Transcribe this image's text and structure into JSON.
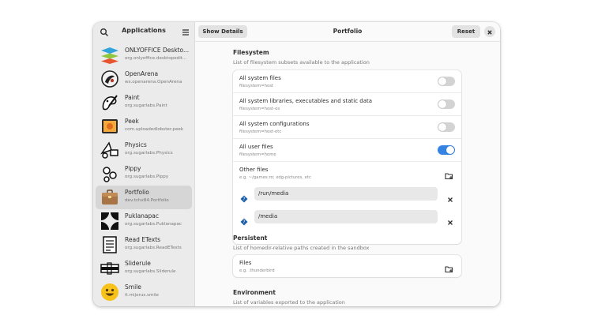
{
  "sidebar": {
    "title": "Applications",
    "apps": [
      {
        "name": "ONLYOFFICE Deskto...",
        "id": "org.onlyoffice.desktopedit...",
        "icon": "onlyoffice-icon"
      },
      {
        "name": "OpenArena",
        "id": "ws.openarena.OpenArena",
        "icon": "openarena-icon"
      },
      {
        "name": "Paint",
        "id": "org.sugarlabs.Paint",
        "icon": "paint-icon"
      },
      {
        "name": "Peek",
        "id": "com.uploadedlobster.peek",
        "icon": "peek-icon"
      },
      {
        "name": "Physics",
        "id": "org.sugarlabs.Physics",
        "icon": "physics-icon"
      },
      {
        "name": "Pippy",
        "id": "org.sugarlabs.Pippy",
        "icon": "pippy-icon"
      },
      {
        "name": "Portfolio",
        "id": "dev.tchx84.Portfolio",
        "icon": "portfolio-icon",
        "selected": true
      },
      {
        "name": "Puklanapac",
        "id": "org.sugarlabs.Puklanapac",
        "icon": "puklanapac-icon"
      },
      {
        "name": "Read ETexts",
        "id": "org.sugarlabs.ReadETexts",
        "icon": "read-etexts-icon"
      },
      {
        "name": "Sliderule",
        "id": "org.sugarlabs.Sliderule",
        "icon": "sliderule-icon"
      },
      {
        "name": "Smile",
        "id": "it.mijorus.smile",
        "icon": "smile-icon"
      }
    ]
  },
  "header": {
    "show_details_label": "Show Details",
    "title": "Portfolio",
    "reset_label": "Reset"
  },
  "filesystem": {
    "title": "Filesystem",
    "description": "List of filesystem subsets available to the application",
    "rows": [
      {
        "label": "All system files",
        "sub": "filesystem=host",
        "on": false
      },
      {
        "label": "All system libraries, executables and static data",
        "sub": "filesystem=host-os",
        "on": false
      },
      {
        "label": "All system configurations",
        "sub": "filesystem=host-etc",
        "on": false
      },
      {
        "label": "All user files",
        "sub": "filesystem=home",
        "on": true
      }
    ],
    "other": {
      "label": "Other files",
      "sub": "e.g. ~/games:ro; xdg-pictures, etc",
      "paths": [
        "/run/media",
        "/media"
      ]
    }
  },
  "persistent": {
    "title": "Persistent",
    "description": "List of homedir-relative paths created in the sandbox",
    "files_label": "Files",
    "files_sub": "e.g. .thunderbird"
  },
  "environment": {
    "title": "Environment",
    "description": "List of variables exported to the application"
  },
  "colors": {
    "accent": "#3584e4",
    "sidebar_bg": "#ebebeb",
    "selected_bg": "#d6d6d6"
  }
}
